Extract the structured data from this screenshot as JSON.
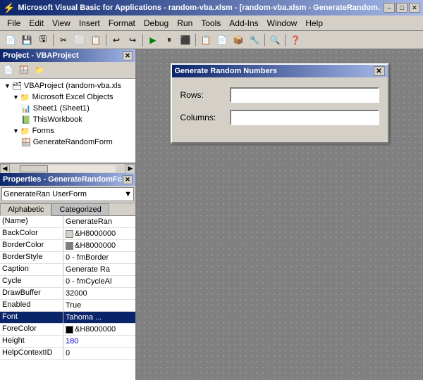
{
  "titlebar": {
    "title": "Microsoft Visual Basic for Applications - random-vba.xlsm - [random-vba.xlsm - GenerateRandom...",
    "icon": "⚡",
    "buttons": [
      "–",
      "□",
      "✕"
    ]
  },
  "menubar": {
    "items": [
      "File",
      "Edit",
      "View",
      "Insert",
      "Format",
      "Debug",
      "Run",
      "Tools",
      "Add-Ins",
      "Window",
      "Help"
    ]
  },
  "toolbar": {
    "buttons": [
      "💾",
      "✂️",
      "📋",
      "↩️",
      "↪️",
      "▶",
      "⏸",
      "⏹",
      "➡️",
      "🔍",
      "📊",
      "🔧",
      "❓"
    ]
  },
  "project_panel": {
    "title": "Project - VBAProject",
    "tree": [
      {
        "label": "VBAProject (random-vba.xls",
        "indent": 0,
        "icon": "📁",
        "arrow": "▼"
      },
      {
        "label": "Microsoft Excel Objects",
        "indent": 1,
        "icon": "📁",
        "arrow": "▼"
      },
      {
        "label": "Sheet1 (Sheet1)",
        "indent": 2,
        "icon": "📄",
        "arrow": ""
      },
      {
        "label": "ThisWorkbook",
        "indent": 2,
        "icon": "📄",
        "arrow": ""
      },
      {
        "label": "Forms",
        "indent": 1,
        "icon": "📁",
        "arrow": "▼"
      },
      {
        "label": "GenerateRandomForm",
        "indent": 2,
        "icon": "🪟",
        "arrow": ""
      }
    ]
  },
  "properties_panel": {
    "title": "Properties - GenerateRandomFc",
    "selector": "GenerateRan  UserForm",
    "tabs": [
      "Alphabetic",
      "Categorized"
    ],
    "active_tab": "Alphabetic",
    "rows": [
      {
        "name": "(Name)",
        "value": "GenerateRan",
        "highlighted": false,
        "color": null
      },
      {
        "name": "BackColor",
        "value": "&H8000000",
        "highlighted": false,
        "color": "#d4d0c8"
      },
      {
        "name": "BorderColor",
        "value": "&H8000000",
        "highlighted": false,
        "color": "#808080"
      },
      {
        "name": "BorderStyle",
        "value": "0 - fmBorder",
        "highlighted": false,
        "color": null
      },
      {
        "name": "Caption",
        "value": "Generate Ra",
        "highlighted": false,
        "color": null
      },
      {
        "name": "Cycle",
        "value": "0 - fmCycleAl",
        "highlighted": false,
        "color": null
      },
      {
        "name": "DrawBuffer",
        "value": "32000",
        "highlighted": false,
        "color": null
      },
      {
        "name": "Enabled",
        "value": "True",
        "highlighted": false,
        "color": null
      },
      {
        "name": "Font",
        "value": "Tahoma  ...",
        "highlighted": true,
        "color": null
      },
      {
        "name": "ForeColor",
        "value": "&H8000000",
        "highlighted": false,
        "color": "#000000"
      },
      {
        "name": "Height",
        "value": "180",
        "highlighted": false,
        "color": null
      },
      {
        "name": "HelpContextID",
        "value": "0",
        "highlighted": false,
        "color": null
      }
    ]
  },
  "form_designer": {
    "title": "Generate Random Numbers",
    "close_btn": "✕",
    "fields": [
      {
        "label": "Rows:",
        "value": ""
      },
      {
        "label": "Columns:",
        "value": ""
      }
    ]
  }
}
